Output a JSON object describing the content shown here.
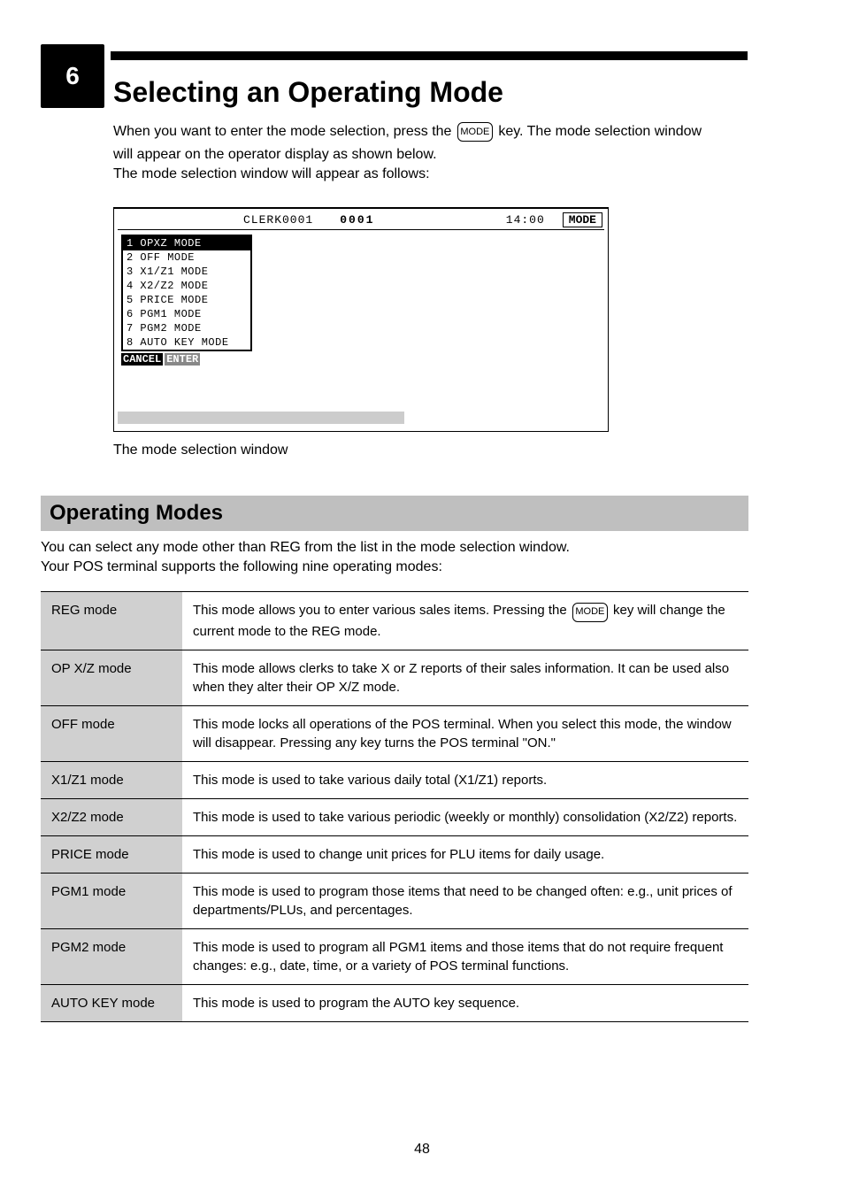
{
  "page": {
    "number_badge": "6",
    "title": "Selecting an Operating Mode",
    "intro_line1_a": "When you want to enter the mode selection, press the ",
    "intro_line1_key": "MODE",
    "intro_line1_b": " key. The mode selection window",
    "intro_line2": "will appear on the operator display as shown below.",
    "intro_line3": "The mode selection window will appear as follows:",
    "figure_caption": "The mode selection window",
    "modes_header": "Operating Modes",
    "modes_intro1": "You can select any mode other than REG from the list in the mode selection window.",
    "modes_intro2": "Your POS terminal supports the following nine operating modes:",
    "page_number": "48"
  },
  "screen": {
    "clerk": "CLERK0001",
    "consec": "0001",
    "time": "14:00",
    "modebox": "MODE",
    "actions": {
      "cancel": "CANCEL",
      "enter": "ENTER"
    },
    "menu": [
      {
        "label": "1 OPXZ MODE",
        "selected": true
      },
      {
        "label": "2 OFF MODE",
        "selected": false
      },
      {
        "label": "3 X1/Z1 MODE",
        "selected": false
      },
      {
        "label": "4 X2/Z2 MODE",
        "selected": false
      },
      {
        "label": "5 PRICE MODE",
        "selected": false
      },
      {
        "label": "6 PGM1 MODE",
        "selected": false
      },
      {
        "label": "7 PGM2 MODE",
        "selected": false
      },
      {
        "label": "8 AUTO KEY MODE",
        "selected": false
      }
    ]
  },
  "modes": [
    {
      "label": "REG mode",
      "desc_a": "This mode allows you to enter various sales items. Pressing the ",
      "key": "MODE",
      "desc_b": " key will change the current mode to the REG mode."
    },
    {
      "label": "OP X/Z mode",
      "desc_a": "This mode allows clerks to take X or Z reports of their sales information. It can be used also when they alter their OP X/Z mode.",
      "key": "",
      "desc_b": ""
    },
    {
      "label": "OFF mode",
      "desc_a": "This mode locks all operations of the POS terminal. When you select this mode, the window will disappear. Pressing any key turns the POS terminal \"ON.\"",
      "key": "",
      "desc_b": ""
    },
    {
      "label": "X1/Z1 mode",
      "desc_a": "This mode is used to take various daily total (X1/Z1) reports.",
      "key": "",
      "desc_b": ""
    },
    {
      "label": "X2/Z2 mode",
      "desc_a": "This mode is used to take various periodic (weekly or monthly) consolidation (X2/Z2) reports.",
      "key": "",
      "desc_b": ""
    },
    {
      "label": "PRICE mode",
      "desc_a": "This mode is used to change unit prices for PLU items for daily usage.",
      "key": "",
      "desc_b": ""
    },
    {
      "label": "PGM1 mode",
      "desc_a": "This mode is used to program those items that need to be changed often: e.g., unit prices of departments/PLUs, and percentages.",
      "key": "",
      "desc_b": ""
    },
    {
      "label": "PGM2 mode",
      "desc_a": "This mode is used to program all PGM1 items and those items that do not require frequent changes: e.g., date, time, or a variety of POS terminal functions.",
      "key": "",
      "desc_b": ""
    },
    {
      "label": "AUTO KEY mode",
      "desc_a": "This mode is used to program the AUTO key sequence.",
      "key": "",
      "desc_b": ""
    }
  ]
}
